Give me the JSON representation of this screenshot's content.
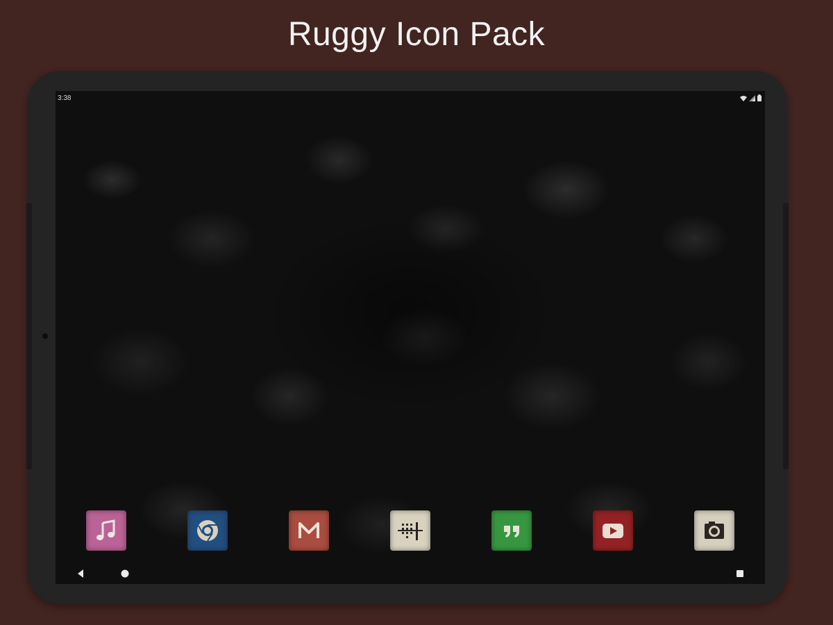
{
  "promo": {
    "title": "Ruggy Icon Pack"
  },
  "status_bar": {
    "time": "3:38",
    "icons": [
      "wifi-icon",
      "cellular-signal-icon",
      "battery-icon"
    ]
  },
  "dock": {
    "apps": [
      {
        "icon": "music-icon",
        "color": "#c2609a"
      },
      {
        "icon": "chrome-browser-icon",
        "color": "#1f4f86"
      },
      {
        "icon": "gmail-icon",
        "color": "#b24a3c"
      },
      {
        "icon": "phone-dialer-icon",
        "color": "#d9d2bd"
      },
      {
        "icon": "hangouts-icon",
        "color": "#2f9a3a"
      },
      {
        "icon": "youtube-icon",
        "color": "#9e1f22"
      },
      {
        "icon": "camera-icon",
        "color": "#d6cfbc"
      }
    ]
  },
  "navigation": {
    "buttons": [
      "back-icon",
      "home-icon",
      "recents-icon"
    ]
  },
  "colors": {
    "background": "#422421",
    "tablet_frame": "#242424",
    "title_text": "#f2f2f2"
  }
}
